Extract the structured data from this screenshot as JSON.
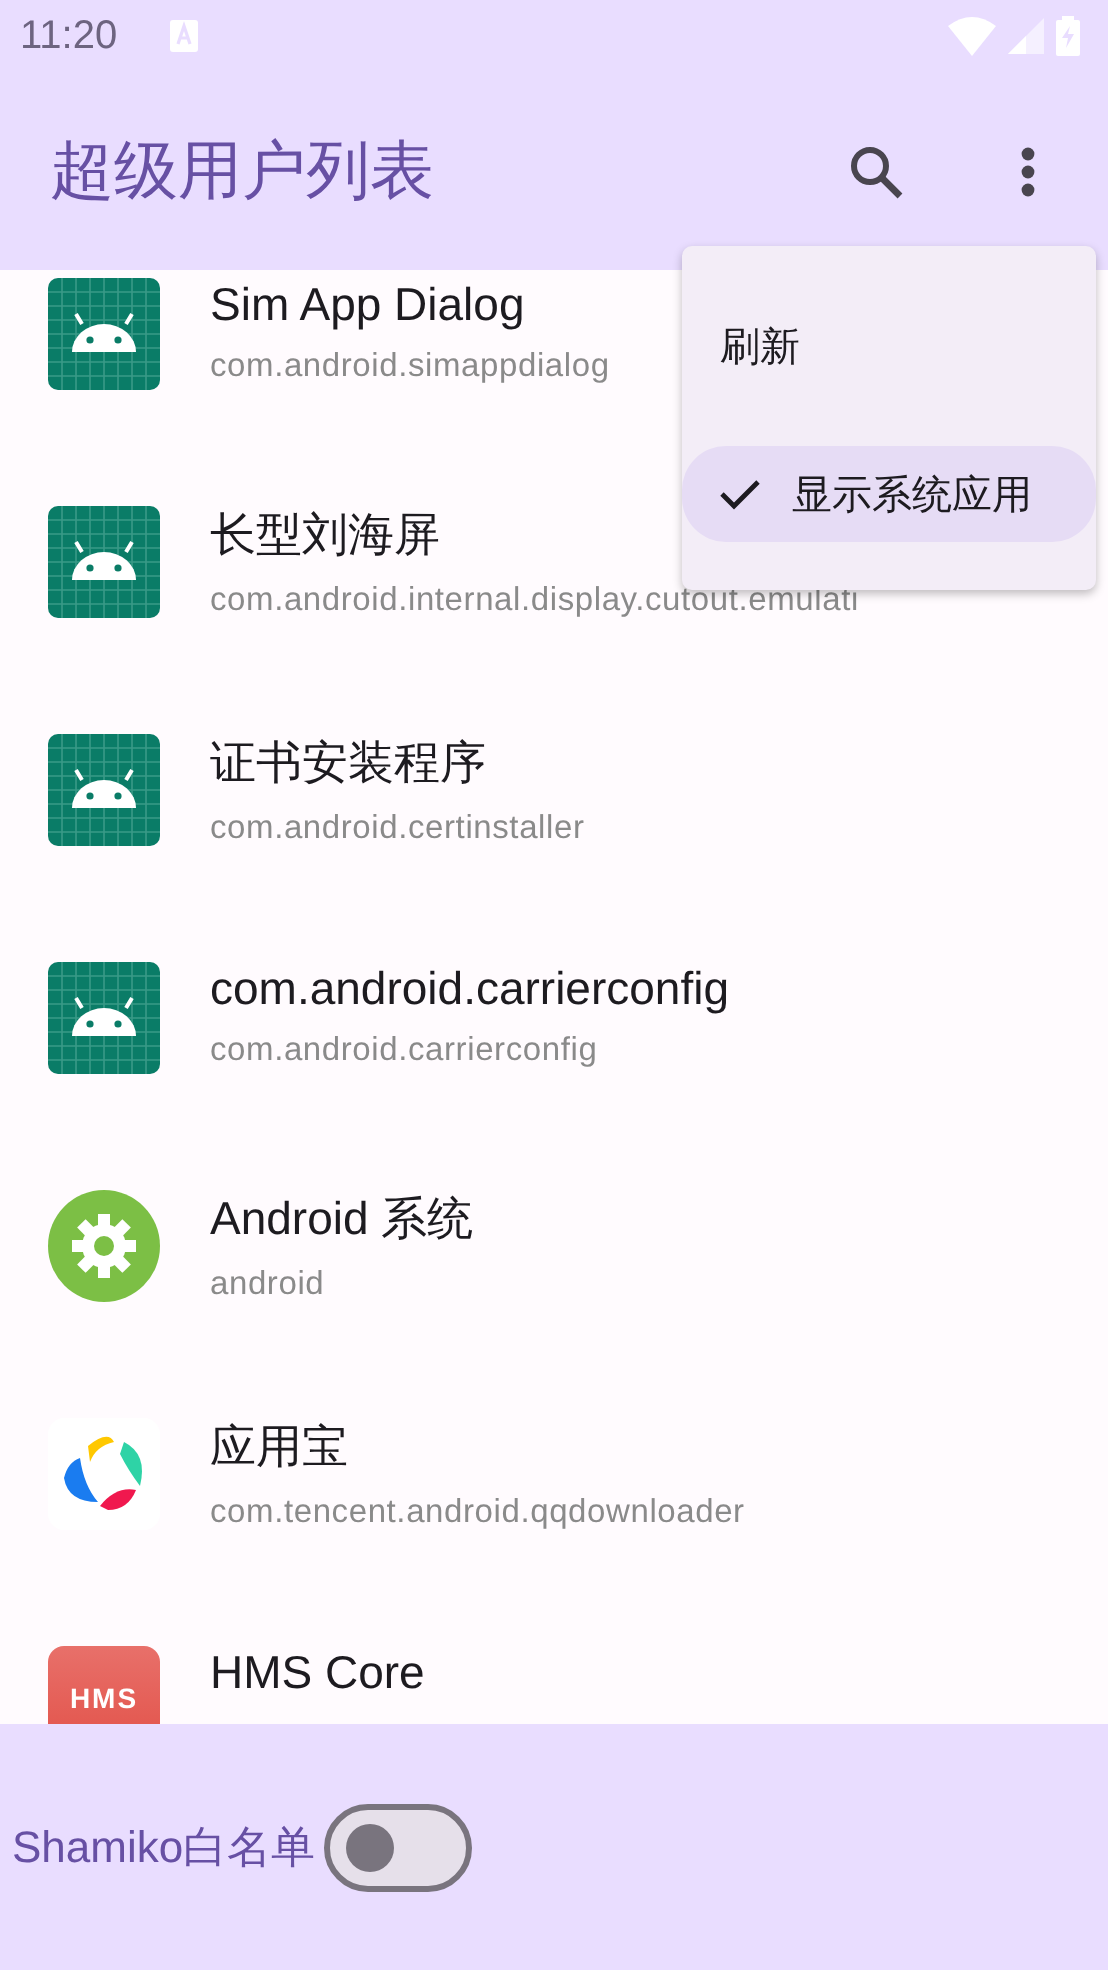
{
  "status_bar": {
    "time": "11:20"
  },
  "app_bar": {
    "title": "超级用户列表"
  },
  "apps": [
    {
      "name": "Sim App Dialog",
      "package": "com.android.simappdialog",
      "kind": "android"
    },
    {
      "name": "长型刘海屏",
      "package": "com.android.internal.display.cutout.emulati",
      "kind": "android"
    },
    {
      "name": "证书安装程序",
      "package": "com.android.certinstaller",
      "kind": "android"
    },
    {
      "name": "com.android.carrierconfig",
      "package": "com.android.carrierconfig",
      "kind": "android"
    },
    {
      "name": "Android 系统",
      "package": "android",
      "kind": "gear"
    },
    {
      "name": "应用宝",
      "package": "com.tencent.android.qqdownloader",
      "kind": "petals"
    },
    {
      "name": "HMS Core",
      "kind": "label",
      "icon_text": "HMS"
    }
  ],
  "menu": {
    "items": [
      {
        "label": "刷新",
        "checked": false,
        "selected": false
      },
      {
        "label": "显示系统应用",
        "checked": true,
        "selected": true
      }
    ]
  },
  "bottom_bar": {
    "label": "Shamiko白名单",
    "on": false
  }
}
